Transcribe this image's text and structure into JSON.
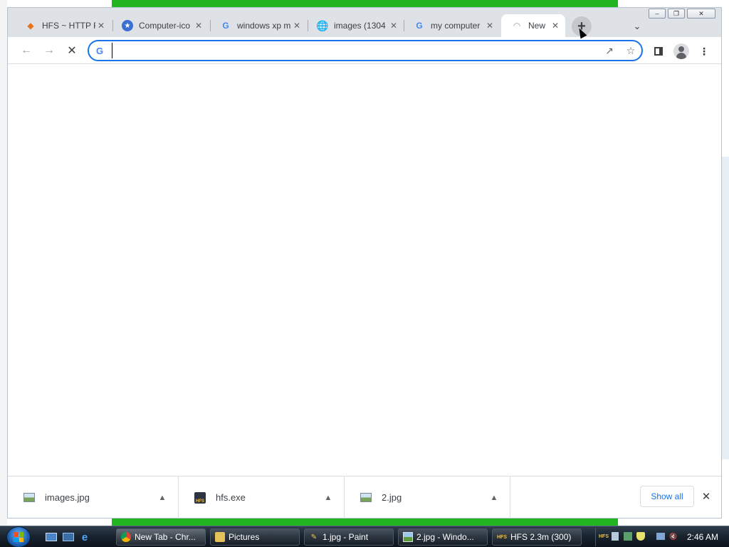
{
  "browser": {
    "tabs": [
      {
        "title": "HFS ~ HTTP F",
        "icon": "hfs-favicon",
        "active": false
      },
      {
        "title": "Computer-ico",
        "icon": "star-favicon",
        "active": false
      },
      {
        "title": "windows xp m",
        "icon": "google-favicon",
        "active": false
      },
      {
        "title": "images (1304",
        "icon": "globe-favicon",
        "active": false
      },
      {
        "title": "my computer",
        "icon": "google-favicon",
        "active": false
      },
      {
        "title": "New",
        "icon": "loading-favicon",
        "active": true
      }
    ],
    "omnibox": {
      "value": "",
      "placeholder": ""
    },
    "colors": {
      "accent": "#1a73e8",
      "tabstrip": "#dee1e6"
    }
  },
  "downloads": {
    "items": [
      {
        "name": "images.jpg",
        "icon": "image-file-icon"
      },
      {
        "name": "hfs.exe",
        "icon": "exe-file-icon"
      },
      {
        "name": "2.jpg",
        "icon": "image-file-icon"
      }
    ],
    "show_all_label": "Show all"
  },
  "taskbar": {
    "buttons": [
      {
        "label": "New Tab - Chr...",
        "icon": "chrome-icon"
      },
      {
        "label": "Pictures",
        "icon": "folder-icon"
      },
      {
        "label": "1.jpg - Paint",
        "icon": "paint-icon"
      },
      {
        "label": "2.jpg - Windo...",
        "icon": "photo-viewer-icon"
      },
      {
        "label": "HFS 2.3m (300)",
        "icon": "hfs-icon"
      }
    ],
    "clock": "2:46 AM"
  }
}
